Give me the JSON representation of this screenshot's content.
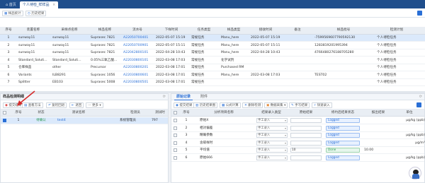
{
  "tabs": {
    "home": "首页",
    "active": "个人待检_样样品"
  },
  "toolbar": {
    "export": "样品统计",
    "history": "历史结果"
  },
  "main_table": {
    "headers": [
      "序号",
      "装置名称",
      "采样点名称",
      "样品名称",
      "流水号",
      "下样时间",
      "任务类型",
      "样品类型",
      "接收时间",
      "备注",
      "样品批号",
      "检测计划"
    ],
    "rows": [
      [
        "1",
        "sunway11",
        "sunway11",
        "Suprasec 7821",
        "A22050700401",
        "2022-05-07 15:19",
        "常规任务",
        "Manu_here",
        "2022-05-07 15:19",
        "",
        "-7599569607790592130",
        "个人待检任务"
      ],
      [
        "2",
        "sunway11",
        "sunway11",
        "Suprasec 7821",
        "A22050700901",
        "2022-05-07 15:11",
        "常规任务",
        "Manu_here",
        "2022-05-07 15:11",
        "",
        "1283819201995394",
        "个人待检任务"
      ],
      [
        "3",
        "sunway11",
        "sunway11",
        "Suprasec 7821",
        "A22042800101",
        "2022-04-28 10:43",
        "常规任务",
        "Manu_here",
        "2022-04-28 10:43",
        "",
        "4766480276188705280",
        "个人待检任务"
      ],
      [
        "4",
        "Standard_Soluti...",
        "Standard_Soluti...",
        "0.05%三氧乙酸...",
        "A22030800101",
        "2022-03-08 17:03",
        "常规任务",
        "化学试剂",
        "",
        "",
        "",
        "个人待检任务"
      ],
      [
        "5",
        "仓库样品",
        "other",
        "Precursor",
        "A22030800201",
        "2022-03-08 17:01",
        "常规任务",
        "Purchased RM",
        "",
        "",
        "",
        "个人待检任务"
      ],
      [
        "6",
        "Variants",
        "ILB8291",
        "Suprasec 1056",
        "A22030800601",
        "2022-03-08 17:01",
        "常规任务",
        "Manu_here",
        "2022-03-08 17:03",
        "",
        "TEST02",
        "个人待检任务"
      ],
      [
        "7",
        "Splitter",
        "EB103",
        "Suprasec 5008",
        "A22030800501",
        "2022-03-08 17:01",
        "常规任务",
        "",
        "",
        "",
        "",
        "个人待检任务"
      ]
    ]
  },
  "left_panel": {
    "title": "样品检测明细",
    "buttons": [
      "提交结果",
      "查看方法",
      "复检回退",
      "退回",
      "更多"
    ],
    "headers": [
      "序号",
      "状态",
      "测试名称",
      "检测员",
      "测试时"
    ],
    "rows": [
      [
        "1",
        "待确认",
        "test4",
        "系统管理员",
        "797"
      ]
    ]
  },
  "right_panel": {
    "tabs": [
      "原始记录",
      "附件"
    ],
    "buttons": [
      "提交结果",
      "历史结果图",
      "公式计算",
      "删除检测",
      "数据采集",
      "手写结果",
      "快速录入"
    ],
    "headers": [
      "序号",
      "分析项目名称",
      "结果录入类型",
      "原始结果",
      "修约后结果状态",
      "报出结果",
      "单位"
    ],
    "rows": [
      [
        "1",
        "原始X",
        "手工录入",
        "",
        "Logged",
        "",
        "μg/kg (ppb)"
      ],
      [
        "2",
        "相对偏差",
        "手工录入",
        "",
        "Logged",
        "",
        ""
      ],
      [
        "3",
        "精确参数",
        "手工录入",
        "",
        "Logged",
        "",
        "μg/kg (ppb)"
      ],
      [
        "4",
        "含碳样时",
        "手工录入",
        "",
        "Logged",
        "",
        "μg/m³"
      ],
      [
        "5",
        "平均值",
        "手工录入",
        "10",
        "Done",
        "10.00",
        ""
      ],
      [
        "6",
        "原始666",
        "手工录入",
        "",
        "Logged",
        "",
        "μg/kg (ppb)"
      ]
    ]
  },
  "colors": {
    "brand": "#1f4e8c",
    "accent": "#2a6fd6",
    "selected_row": "#dbe9fb",
    "done": "#2d9a55",
    "arrow": "#d62b2b"
  }
}
